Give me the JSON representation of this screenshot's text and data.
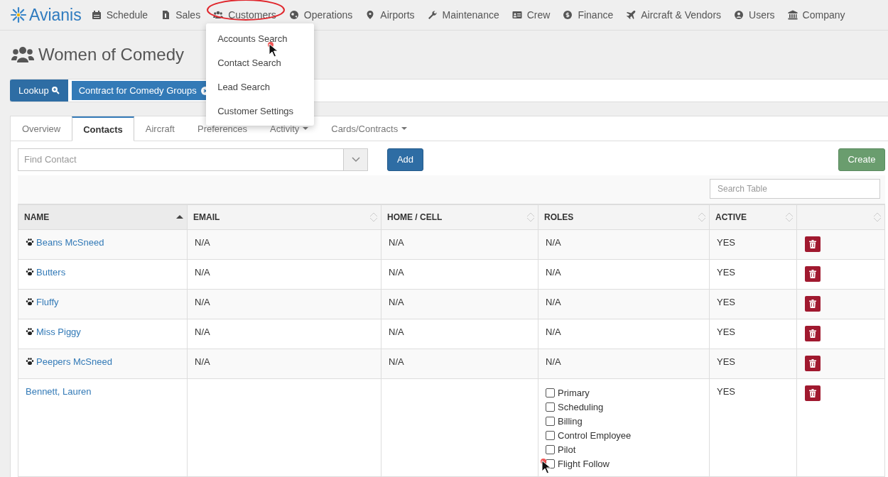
{
  "nav": {
    "logo": "Avianis",
    "items": [
      {
        "label": "Schedule",
        "highlighted": false
      },
      {
        "label": "Sales",
        "highlighted": false
      },
      {
        "label": "Customers",
        "highlighted": true,
        "menu": [
          {
            "label": "Accounts Search",
            "pointer": true
          },
          {
            "label": "Contact Search",
            "pointer": false
          },
          {
            "label": "Lead Search",
            "pointer": false
          },
          {
            "label": "Customer Settings",
            "pointer": false
          }
        ]
      },
      {
        "label": "Operations",
        "highlighted": false
      },
      {
        "label": "Airports",
        "highlighted": false
      },
      {
        "label": "Maintenance",
        "highlighted": false
      },
      {
        "label": "Crew",
        "highlighted": false
      },
      {
        "label": "Finance",
        "highlighted": false
      },
      {
        "label": "Aircraft & Vendors",
        "highlighted": false
      },
      {
        "label": "Users",
        "highlighted": false
      },
      {
        "label": "Company",
        "highlighted": false
      }
    ]
  },
  "page_title": "Women of Comedy",
  "lookup": {
    "button": "Lookup",
    "tags": [
      "Contract for Comedy Groups"
    ]
  },
  "tabs": [
    {
      "label": "Overview",
      "selected": false,
      "dropdown": false
    },
    {
      "label": "Contacts",
      "selected": true,
      "dropdown": false
    },
    {
      "label": "Aircraft",
      "selected": false,
      "dropdown": false
    },
    {
      "label": "Preferences",
      "selected": false,
      "dropdown": false
    },
    {
      "label": "Activity",
      "selected": false,
      "dropdown": true
    },
    {
      "label": "Cards/Contracts",
      "selected": false,
      "dropdown": true
    }
  ],
  "find_contact": {
    "placeholder": "Find Contact"
  },
  "add_button": "Add",
  "create_button": "Create",
  "search_table": {
    "placeholder": "Search Table"
  },
  "table": {
    "columns": [
      {
        "label": "NAME",
        "sorted": true
      },
      {
        "label": "EMAIL",
        "sorted": false
      },
      {
        "label": "HOME / CELL",
        "sorted": false
      },
      {
        "label": "ROLES",
        "sorted": false
      },
      {
        "label": "ACTIVE",
        "sorted": false
      },
      {
        "sorted": false
      }
    ],
    "rows": [
      {
        "kind": "pet",
        "name": "Beans McSneed",
        "email": "N/A",
        "phone": "N/A",
        "roles": "N/A",
        "active": "YES"
      },
      {
        "kind": "pet",
        "name": "Butters",
        "email": "N/A",
        "phone": "N/A",
        "roles": "N/A",
        "active": "YES"
      },
      {
        "kind": "pet",
        "name": "Fluffy",
        "email": "N/A",
        "phone": "N/A",
        "roles": "N/A",
        "active": "YES"
      },
      {
        "kind": "pet",
        "name": "Miss Piggy",
        "email": "N/A",
        "phone": "N/A",
        "roles": "N/A",
        "active": "YES"
      },
      {
        "kind": "pet",
        "name": "Peepers McSneed",
        "email": "N/A",
        "phone": "N/A",
        "roles": "N/A",
        "active": "YES"
      },
      {
        "kind": "person",
        "name": "Bennett, Lauren",
        "active": "YES",
        "role_options": [
          {
            "label": "Primary",
            "checked": false,
            "pointer": false
          },
          {
            "label": "Scheduling",
            "checked": false,
            "pointer": false
          },
          {
            "label": "Billing",
            "checked": false,
            "pointer": false
          },
          {
            "label": "Control Employee",
            "checked": false,
            "pointer": false
          },
          {
            "label": "Pilot",
            "checked": false,
            "pointer": false
          },
          {
            "label": "Flight Follow",
            "checked": false,
            "pointer": true
          }
        ]
      }
    ]
  }
}
